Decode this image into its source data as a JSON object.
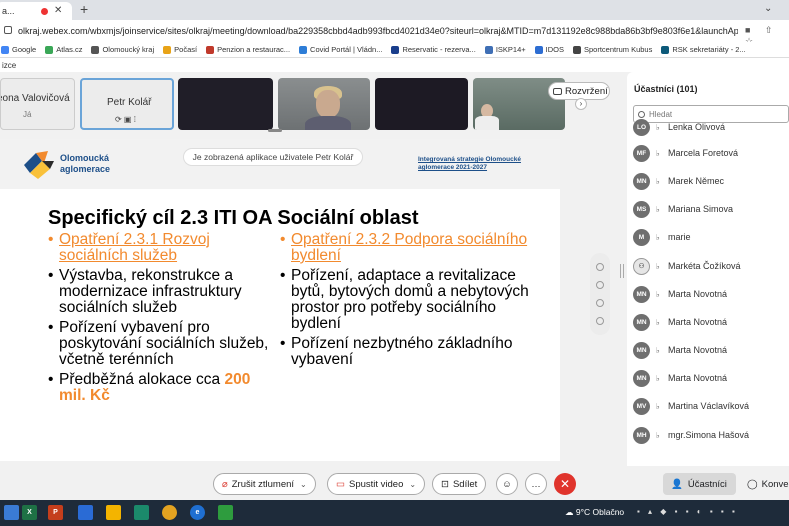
{
  "browser": {
    "tab_title": "a...",
    "url": "olkraj.webex.com/wbxmjs/joinservice/sites/olkraj/meeting/download/ba229358cbbd4adb993fbcd4021d34e0?siteurl=olkraj&MTID=m7d131192e8c988bda86b3bf9e803f6e1&launchApp=true",
    "bookmarks": [
      "Google",
      "Atlas.cz",
      "Olomoucký kraj",
      "Počasí",
      "Penzion a restaurac...",
      "Covid Portál | Vládn...",
      "Reservatic - rezerva...",
      "ISKP14+",
      "IDOS",
      "Sportcentrum Kubus",
      "RSK sekretariáty - 2..."
    ],
    "app_strip_label": "izce"
  },
  "video_strip": {
    "tile_leona_name": "eona Valovičová",
    "tile_leona_me": "Já",
    "tile_petr_name": "Petr Kolář",
    "layout_button": "Rozvržení"
  },
  "slide": {
    "org_name_line1": "Olomoucká",
    "org_name_line2": "aglomerace",
    "sharing_notice": "Je zobrazená aplikace uživatele Petr Kolář",
    "strategy_line1": "Integrovaná strategie Olomoucké",
    "strategy_line2": "aglomerace 2021-2027",
    "title": "Specifický cíl 2.3 ITI OA Sociální oblast",
    "left_heading": "Opatření 2.3.1 Rozvoj sociálních služeb",
    "left_items": [
      "Výstavba, rekonstrukce a modernizace infrastruktury sociálních služeb",
      "Pořízení vybavení pro poskytování sociálních služeb, včetně terénních"
    ],
    "alloc_prefix": "Předběžná alokace cca",
    "alloc_amount": "200 mil. Kč",
    "right_heading": "Opatření 2.3.2 Podpora sociálního bydlení",
    "right_items": [
      "Pořízení, adaptace a revitalizace bytů, bytových domů a nebytových prostor pro potřeby sociálního bydlení",
      "Pořízení nezbytného základního vybavení"
    ],
    "colors": {
      "accent": "#f28a2e",
      "brand": "#1d4f89"
    }
  },
  "participants": {
    "title": "Účastníci (101)",
    "search_placeholder": "Hledat",
    "list": [
      {
        "initials": "LO",
        "name": "Lenka Olivová"
      },
      {
        "initials": "MF",
        "name": "Marcela Foretová"
      },
      {
        "initials": "MN",
        "name": "Marek Němec"
      },
      {
        "initials": "MS",
        "name": "Mariana Simova"
      },
      {
        "initials": "M",
        "name": "marie"
      },
      {
        "initials": "",
        "name": "Markéta Čožíková"
      },
      {
        "initials": "MN",
        "name": "Marta Novotná"
      },
      {
        "initials": "MN",
        "name": "Marta Novotná"
      },
      {
        "initials": "MN",
        "name": "Marta Novotná"
      },
      {
        "initials": "MN",
        "name": "Marta Novotná"
      },
      {
        "initials": "MV",
        "name": "Martina Václavíková"
      },
      {
        "initials": "MH",
        "name": "mgr.Simona Hašová"
      }
    ]
  },
  "controls": {
    "mute": "Zrušit ztlumení",
    "video": "Spustit video",
    "share": "Sdílet",
    "participants": "Účastníci",
    "chat": "Konve"
  },
  "taskbar": {
    "weather": "9°C  Oblačno"
  }
}
